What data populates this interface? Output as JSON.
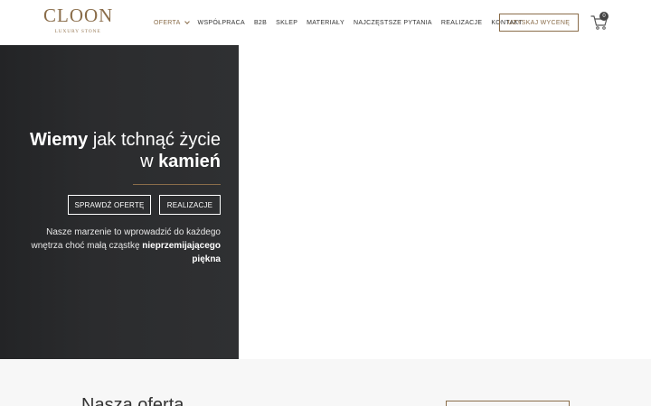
{
  "header": {
    "logo": {
      "main": "CLOON",
      "sub": "LUXURY STONE"
    },
    "nav": [
      {
        "label": "OFERTA",
        "active": true,
        "dropdown": true
      },
      {
        "label": "WSPÓŁPRACA"
      },
      {
        "label": "B2B"
      },
      {
        "label": "SKLEP"
      },
      {
        "label": "MATERIAŁY"
      },
      {
        "label": "NAJCZĘSTSZE PYTANIA"
      },
      {
        "label": "REALIZACJE"
      },
      {
        "label": "KONTAKT"
      }
    ],
    "quote_button": "UZYSKAJ WYCENĘ",
    "cart_count": "0",
    "cart_icon": "shopping-cart-icon"
  },
  "hero": {
    "title_bold_1": "Wiemy",
    "title_light_1": " jak tchnąć życie",
    "title_light_2": "w ",
    "title_bold_2": "kamień",
    "button_offer": "SPRAWDŹ OFERTĘ",
    "button_projects": "REALIZACJE",
    "text_1": "Nasze marzenie to wprowadzić do każdego wnętrza choć małą cząstkę ",
    "text_bold": "nieprzemijającego piękna"
  },
  "section": {
    "title": "Nasza oferta"
  },
  "colors": {
    "accent": "#8a6d4a",
    "hero_bg": "#2b2c2e",
    "section_bg": "#f7f7f7"
  }
}
